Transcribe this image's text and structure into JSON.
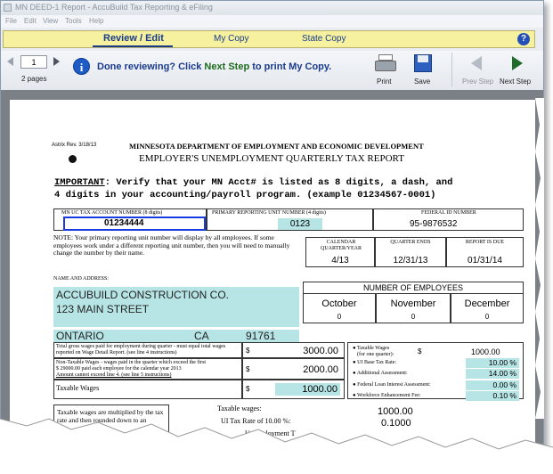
{
  "window": {
    "title": "MN DEED-1 Report - AccuBuild Tax Reporting & eFiling",
    "menu": [
      "File",
      "Edit",
      "View",
      "Tools",
      "Help"
    ]
  },
  "tabs": [
    "Review / Edit",
    "My Copy",
    "State Copy"
  ],
  "toolbar": {
    "page_value": "1",
    "pages_label": "2 pages",
    "message_part1": "Done reviewing? Click ",
    "message_highlight": "Next Step",
    "message_part2": " to print My Copy.",
    "print_label": "Print",
    "save_label": "Save",
    "prev_label": "Prev Step",
    "next_label": "Next Step"
  },
  "form": {
    "rev": "Astrix Rev. 3/18/13",
    "dept": "MINNESOTA DEPARTMENT OF EMPLOYMENT AND ECONOMIC DEVELOPMENT",
    "report_title": "EMPLOYER'S UNEMPLOYMENT QUARTERLY TAX REPORT",
    "important_label": "IMPORTANT",
    "important_line1": ": Verify that your MN Acct# is listed as 8 digits, a dash, and",
    "important_line2": "4 digits in your accounting/payroll program. (example 01234567-0001)",
    "acct_label": "MN UC TAX ACCOUNT NUMBER (8 digits)",
    "acct_value": "01234444",
    "unit_label": "PRIMARY REPORTING UNIT NUMBER (4 digits)",
    "unit_value": "0123",
    "fed_label": "FEDERAL ID NUMBER",
    "fed_value": "95-9876532",
    "note": "NOTE:  Your primary reporting unit number will display by all employees.   If some employees work under a different reporting unit number, then you will need to manually change the number by their name.",
    "cal_label": "CALENDAR QUARTER/YEAR",
    "cal_value": "4/13",
    "qe_label": "QUARTER ENDS",
    "qe_value": "12/31/13",
    "due_label": "REPORT IS DUE",
    "due_value": "01/31/14",
    "name_label": "NAME AND ADDRESS:",
    "company": "ACCUBUILD CONSTRUCTION CO.",
    "street": "123 MAIN STREET",
    "city": "ONTARIO",
    "state": "CA",
    "zip": "91761",
    "emp_label": "NUMBER OF EMPLOYEES",
    "months": [
      {
        "name": "October",
        "count": "0"
      },
      {
        "name": "November",
        "count": "0"
      },
      {
        "name": "December",
        "count": "0"
      }
    ],
    "gross_label": "Total gross wages paid for employment during quarter - must equal total wages reported on Wage Detail Report. (see line 4 instructions)",
    "gross_value": "3000.00",
    "nontax_label1": "Non-Taxable Wages - wages paid in the quarter which exceed the first",
    "nontax_label2": "$   29000.00 paid each employee for the calendar year  2013",
    "nontax_label3": "Amount cannot exceed line 4. (see line 5 instructions)",
    "nontax_value": "2000.00",
    "taxable_label": "Taxable Wages",
    "taxable_value": "1000.00",
    "dollar": "$",
    "rt_taxable_label": "Taxable Wages",
    "rt_taxable_sub": "(for one quarter):",
    "rt_taxable_value": "1000.00",
    "base_rate_label": "UI Base Tax Rate:",
    "base_rate_value": "10.00 %",
    "addl_label": "Additional Assessment:",
    "addl_value": "14.00 %",
    "fed_loan_label": "Federal Loan Interest Assessment:",
    "fed_loan_value": "0.00 %",
    "wef_label": "Workforce Enhancement Fee:",
    "wef_value": "0.10 %",
    "mult_label": "Taxable wages are multiplied by the tax rate and then rounded down to an",
    "bottom_taxable_label": "Taxable wages:",
    "bottom_taxable_value": "1000.00",
    "ui_rate_label": "UI Tax Rate of  10.00  %:",
    "ui_rate_value": "0.1000",
    "unemp_label": "Unemployment T"
  }
}
